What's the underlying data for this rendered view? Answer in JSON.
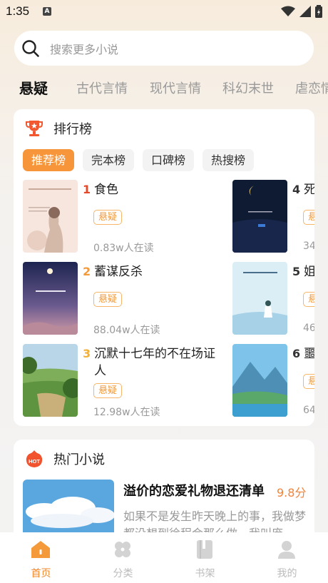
{
  "status": {
    "time": "1:35",
    "notice_letter": "A"
  },
  "search": {
    "placeholder": "搜索更多小说"
  },
  "categories": [
    "悬疑",
    "古代言情",
    "现代言情",
    "科幻末世",
    "虐恋情"
  ],
  "ranking": {
    "title": "排行榜",
    "tabs": [
      "推荐榜",
      "完本榜",
      "口碑榜",
      "热搜榜"
    ],
    "active_tab": "推荐榜",
    "books": [
      {
        "rank": "1",
        "title": "食色",
        "tag": "悬疑",
        "readers": "0.83w人在读"
      },
      {
        "rank": "2",
        "title": "蓄谋反杀",
        "tag": "悬疑",
        "readers": "88.04w人在读"
      },
      {
        "rank": "3",
        "title": "沉默十七年的不在场证人",
        "tag": "悬疑",
        "readers": "12.98w人在读"
      },
      {
        "rank": "4",
        "title": "死",
        "tag": "悬",
        "readers": "34"
      },
      {
        "rank": "5",
        "title": "姐",
        "tag": "悬",
        "readers": "46"
      },
      {
        "rank": "6",
        "title": "噩",
        "tag": "悬",
        "readers": "64"
      }
    ]
  },
  "hot": {
    "title": "热门小说",
    "badge": "HOT",
    "book": {
      "title": "溢价的恋爱礼物退还清单",
      "score": "9.8分",
      "desc": "如果不是发生昨天晚上的事，我做梦都没想到徐程会那么做，我叫庞"
    }
  },
  "nav": [
    "首页",
    "分类",
    "书架",
    "我的"
  ],
  "colors": {
    "accent": "#f6953a",
    "rank1": "#e24a2b",
    "rank2": "#f39a3c",
    "rank3": "#f2b03a"
  }
}
